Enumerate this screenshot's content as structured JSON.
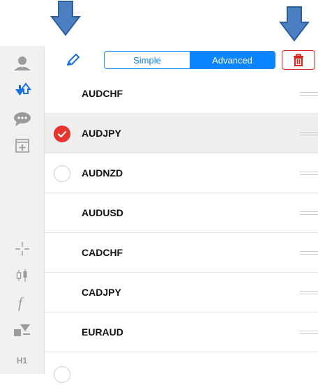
{
  "toolbar": {
    "mode_simple": "Simple",
    "mode_advanced": "Advanced",
    "active_mode": "Advanced"
  },
  "sidebar": {
    "timeframe": "H1"
  },
  "symbols": [
    {
      "name": "AUDCHF",
      "checkbox": "hidden"
    },
    {
      "name": "AUDJPY",
      "checkbox": "checked"
    },
    {
      "name": "AUDNZD",
      "checkbox": "unchecked"
    },
    {
      "name": "AUDUSD",
      "checkbox": "hidden"
    },
    {
      "name": "CADCHF",
      "checkbox": "hidden"
    },
    {
      "name": "CADJPY",
      "checkbox": "hidden"
    },
    {
      "name": "EURAUD",
      "checkbox": "hidden"
    }
  ],
  "colors": {
    "accent": "#0a84ff",
    "delete": "#d9261c",
    "check": "#e8352b",
    "arrow": "#4a7fc1"
  }
}
